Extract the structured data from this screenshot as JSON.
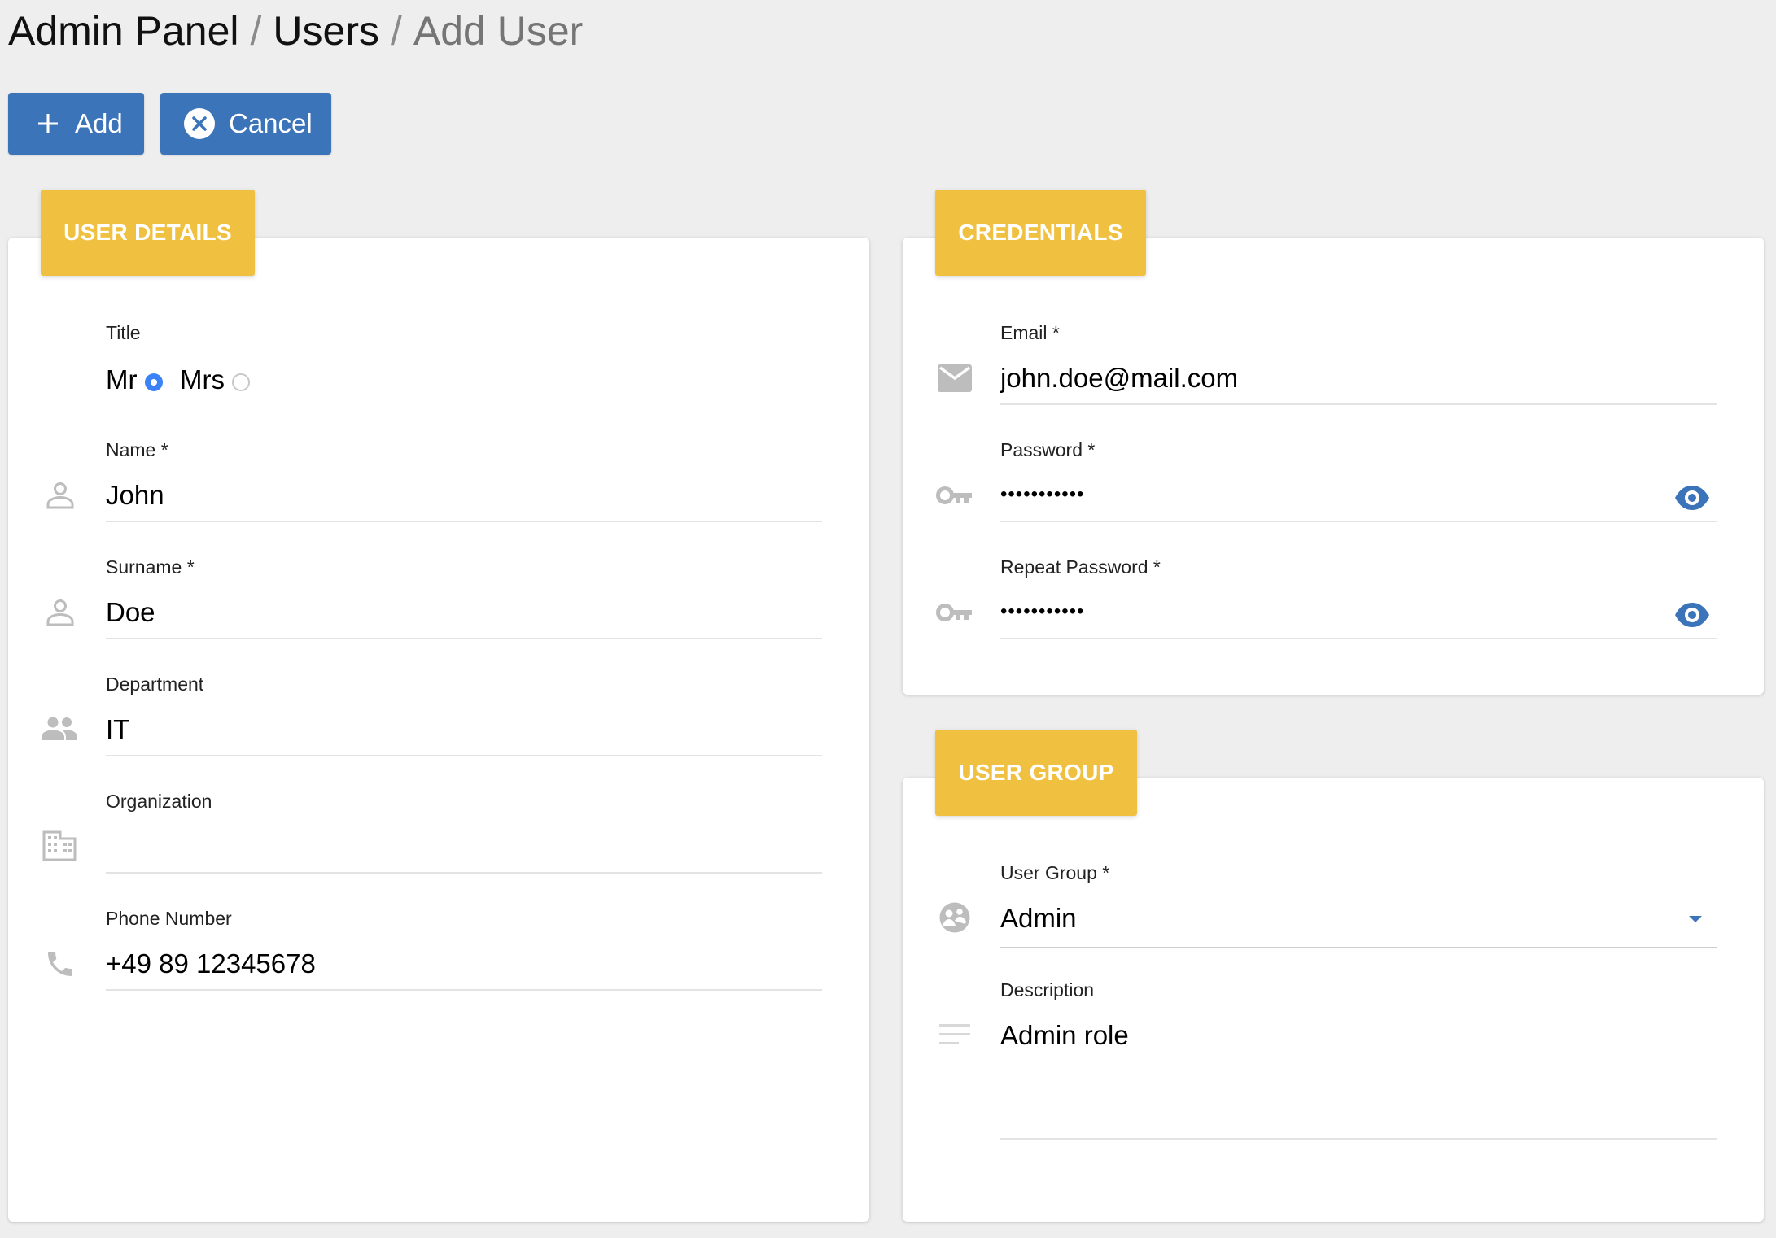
{
  "breadcrumb": {
    "items": [
      "Admin Panel",
      "Users",
      "Add User"
    ],
    "separator": "/"
  },
  "toolbar": {
    "add_label": "Add",
    "cancel_label": "Cancel"
  },
  "user_details": {
    "header": "USER DETAILS",
    "title": {
      "label": "Title",
      "options": [
        "Mr",
        "Mrs"
      ],
      "selected": "Mr"
    },
    "name": {
      "label": "Name *",
      "value": "John",
      "icon": "person-icon"
    },
    "surname": {
      "label": "Surname *",
      "value": "Doe",
      "icon": "person-icon"
    },
    "department": {
      "label": "Department",
      "value": "IT",
      "icon": "group-icon"
    },
    "organization": {
      "label": "Organization",
      "value": "",
      "icon": "building-icon"
    },
    "phone": {
      "label": "Phone Number",
      "value": "+49 89 12345678",
      "icon": "phone-icon"
    }
  },
  "credentials": {
    "header": "CREDENTIALS",
    "email": {
      "label": "Email *",
      "value": "john.doe@mail.com",
      "icon": "mail-icon"
    },
    "password": {
      "label": "Password *",
      "value": "•••••••••••",
      "icon": "key-icon"
    },
    "repeat_password": {
      "label": "Repeat Password *",
      "value": "•••••••••••",
      "icon": "key-icon"
    }
  },
  "user_group": {
    "header": "USER GROUP",
    "group": {
      "label": "User Group *",
      "value": "Admin",
      "icon": "group-face-icon"
    },
    "description": {
      "label": "Description",
      "value": "Admin role",
      "icon": "notes-icon"
    }
  },
  "colors": {
    "button": "#3c74b9",
    "header": "#f0c040",
    "accent": "#3b82f6",
    "icon": "#bdbdbd",
    "background": "#eeeeee"
  }
}
